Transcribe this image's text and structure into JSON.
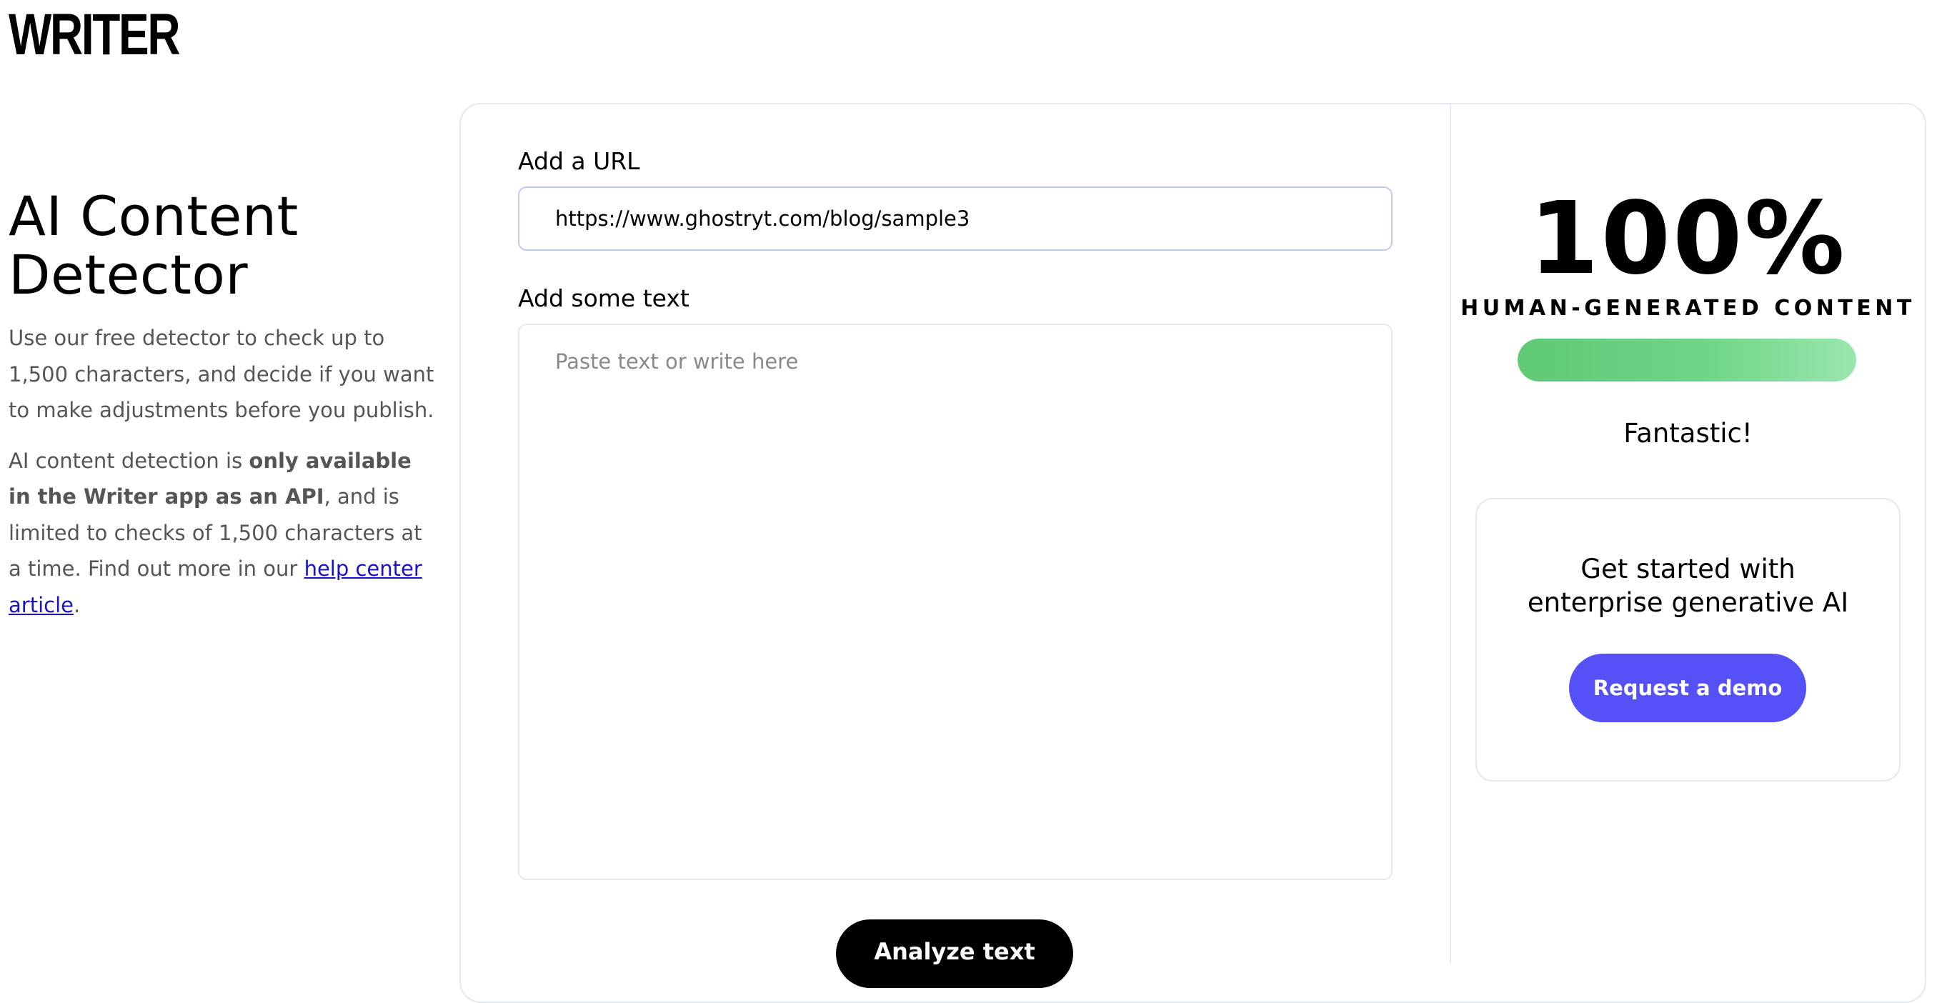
{
  "brand": {
    "logo_text": "WRITER"
  },
  "intro": {
    "title_line1": "AI Content",
    "title_line2": "Detector",
    "paragraph1": "Use our free detector to check up to 1,500 characters, and decide if you want to make adjustments before you publish.",
    "paragraph2_prefix": "AI content detection is ",
    "paragraph2_bold": "only available in the Writer app as an API",
    "paragraph2_middle": ", and is limited to checks of 1,500 characters at a time. Find out more in our ",
    "paragraph2_link": "help center article",
    "paragraph2_suffix": "."
  },
  "form": {
    "url_label": "Add a URL",
    "url_value": "https://www.ghostryt.com/blog/sample3",
    "text_label": "Add some text",
    "text_placeholder": "Paste text or write here",
    "text_value": "",
    "analyze_label": "Analyze text"
  },
  "result": {
    "score_text": "100%",
    "score_fraction": 1.0,
    "caption": "HUMAN-GENERATED CONTENT",
    "verdict": "Fantastic!",
    "meter_color": "#6fd585"
  },
  "promo": {
    "title_line1": "Get started with",
    "title_line2": "enterprise generative AI",
    "button_label": "Request a demo",
    "button_color": "#5551f6"
  }
}
